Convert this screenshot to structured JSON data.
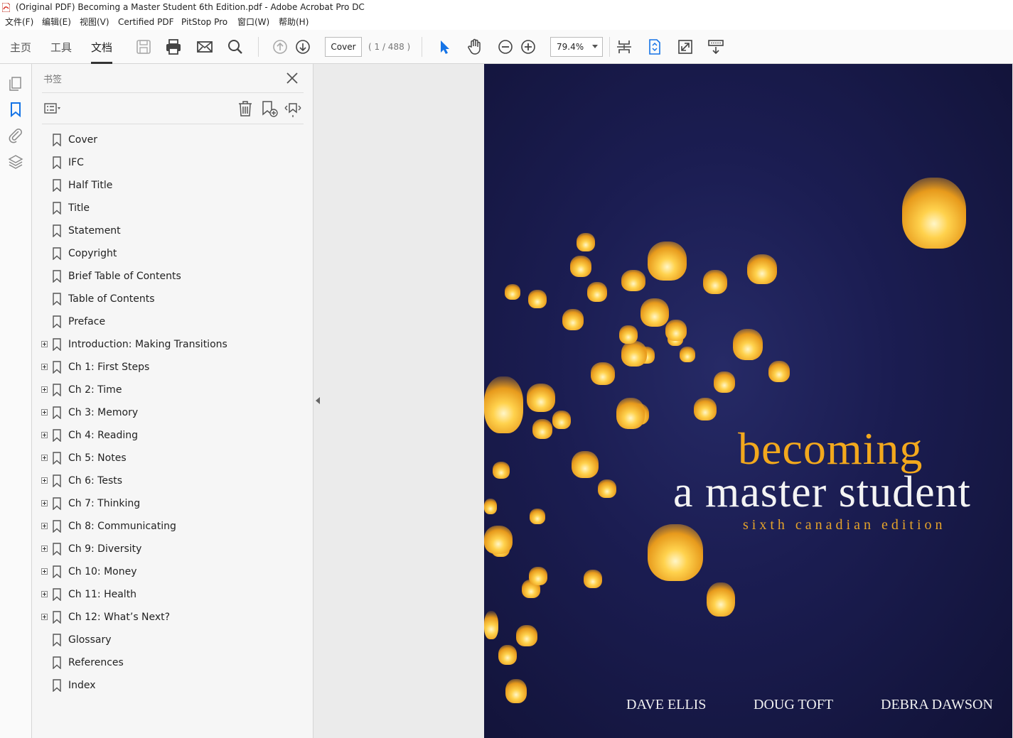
{
  "window": {
    "title": "(Original PDF) Becoming a Master Student 6th Edition.pdf - Adobe Acrobat Pro DC"
  },
  "menu": [
    "文件(F)",
    "编辑(E)",
    "视图(V)",
    "Certified PDF",
    "PitStop Pro",
    "窗口(W)",
    "帮助(H)"
  ],
  "nav": {
    "home": "主页",
    "tools": "工具",
    "document": "文档"
  },
  "toolbar": {
    "page_field": "Cover",
    "page_count": "( 1 / 488 )",
    "zoom": "79.4%"
  },
  "bookmarks_panel": {
    "title": "书签",
    "items": [
      {
        "label": "Cover",
        "expandable": false
      },
      {
        "label": "IFC",
        "expandable": false
      },
      {
        "label": "Half Title",
        "expandable": false
      },
      {
        "label": "Title",
        "expandable": false
      },
      {
        "label": "Statement",
        "expandable": false
      },
      {
        "label": "Copyright",
        "expandable": false
      },
      {
        "label": "Brief Table of Contents",
        "expandable": false
      },
      {
        "label": "Table of Contents",
        "expandable": false
      },
      {
        "label": "Preface",
        "expandable": false
      },
      {
        "label": "Introduction: Making Transitions",
        "expandable": true
      },
      {
        "label": "Ch 1: First Steps",
        "expandable": true
      },
      {
        "label": "Ch 2: Time",
        "expandable": true
      },
      {
        "label": "Ch 3: Memory",
        "expandable": true
      },
      {
        "label": "Ch 4: Reading",
        "expandable": true
      },
      {
        "label": "Ch 5: Notes",
        "expandable": true
      },
      {
        "label": "Ch 6: Tests",
        "expandable": true
      },
      {
        "label": "Ch 7: Thinking",
        "expandable": true
      },
      {
        "label": "Ch 8: Communicating",
        "expandable": true
      },
      {
        "label": "Ch 9: Diversity",
        "expandable": true
      },
      {
        "label": "Ch 10: Money",
        "expandable": true
      },
      {
        "label": "Ch 11: Health",
        "expandable": true
      },
      {
        "label": "Ch 12: What’s Next?",
        "expandable": true
      },
      {
        "label": "Glossary",
        "expandable": false
      },
      {
        "label": "References",
        "expandable": false
      },
      {
        "label": "Index",
        "expandable": false
      }
    ]
  },
  "cover": {
    "title_line1": "becoming",
    "title_line2": "a master student",
    "edition": "sixth canadian edition",
    "authors": [
      "DAVE ELLIS",
      "DOUG TOFT",
      "DEBRA DAWSON"
    ]
  },
  "colors": {
    "accent_blue": "#1473e6",
    "cover_orange": "#f2a81d",
    "cover_bg": "#1b1d52"
  }
}
